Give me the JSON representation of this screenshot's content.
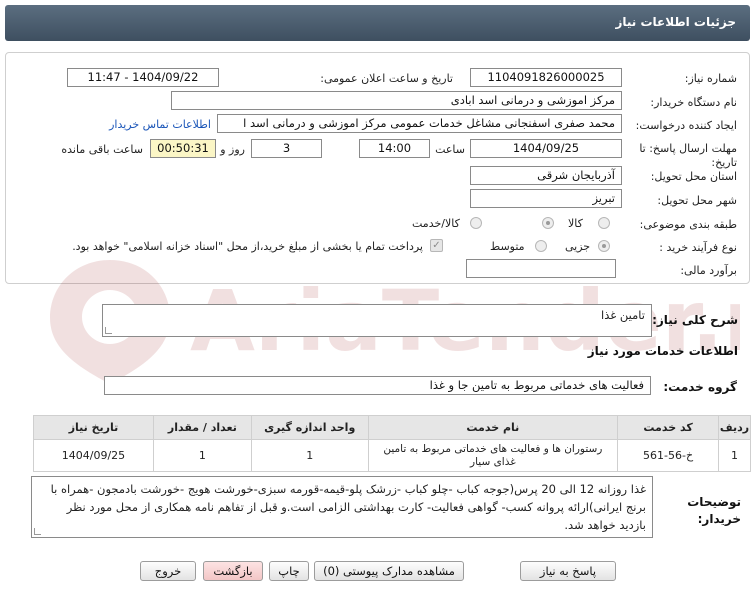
{
  "header": {
    "title": "جزئیات اطلاعات نیاز"
  },
  "fields": {
    "need_number_label": "شماره نیاز:",
    "need_number": "1104091826000025",
    "announce_label": "تاریخ و ساعت اعلان عمومی:",
    "announce_value": "1404/09/22 - 11:47",
    "buyer_org_label": "نام دستگاه خریدار:",
    "buyer_org": "مرکز اموزشی و درمانی اسد ابادی",
    "creator_label": "ایجاد کننده درخواست:",
    "creator": "محمد  صفری اسفنجانی مشاغل خدمات عمومی مرکز اموزشی و درمانی اسد ا",
    "contact_link": "اطلاعات تماس خریدار",
    "deadline_label": "مهلت ارسال پاسخ: تا تاریخ:",
    "deadline_date": "1404/09/25",
    "time_label": "ساعت",
    "deadline_time": "14:00",
    "days_value": "3",
    "days_label": "روز و",
    "remaining_time": "00:50:31",
    "remaining_label": "ساعت باقی مانده",
    "province_label": "استان محل تحویل:",
    "province": "آذربایجان شرقی",
    "city_label": "شهر محل تحویل:",
    "city": "تبریز",
    "category_label": "طبقه بندی موضوعی:",
    "category_options": [
      "کالا",
      "کالا/خدمت"
    ],
    "category_selected": "خدمت",
    "process_label": "نوع فرآیند خرید :",
    "process_options": [
      "جزیی",
      "متوسط"
    ],
    "payment_note": "پرداخت تمام یا بخشی از مبلغ خرید،از محل \"اسناد خزانه اسلامی\" خواهد بود.",
    "budget_label": "برآورد مالی:",
    "budget_value": ""
  },
  "summary": {
    "label": "شرح کلی نیاز:",
    "value": "تامین غذا"
  },
  "services": {
    "section_title": "اطلاعات خدمات مورد نیاز",
    "group_label": "گروه خدمت:",
    "group_value": "فعالیت های خدماتی مربوط به تامین جا و غذا"
  },
  "table": {
    "headers": [
      "ردیف",
      "کد خدمت",
      "نام خدمت",
      "واحد اندازه گیری",
      "تعداد / مقدار",
      "تاریخ نیاز"
    ],
    "rows": [
      [
        "1",
        "خ-56-561",
        "رستوران ها و فعالیت های خدماتی مربوط به تامین غذای سیار",
        "1",
        "1",
        "1404/09/25"
      ]
    ]
  },
  "buyer_notes": {
    "label": "توضیحات خریدار:",
    "value": "غذا روزانه 12 الی 20 پرس(جوجه کباب -چلو کباب -زرشک پلو-قیمه-قورمه سبزی-خورشت هویج -خورشت بادمجون -همراه با برنج ایرانی)ارائه پروانه کسب- گواهی فعالیت- کارت بهداشتی الزامی است.و قبل از تفاهم نامه همکاری از محل مورد نظر بازدید خواهد شد."
  },
  "buttons": {
    "reply": "پاسخ به نیاز",
    "attachments": "مشاهده مدارک پیوستی (0)",
    "print": "چاپ",
    "back": "بازگشت",
    "exit": "خروج"
  },
  "watermark": "AriaTender.neT",
  "colors": {
    "title_bar": "#4a5c6e",
    "link": "#1a55b8",
    "remaining_bg": "#fbf6c6",
    "back_btn": "#f3c6c6"
  }
}
